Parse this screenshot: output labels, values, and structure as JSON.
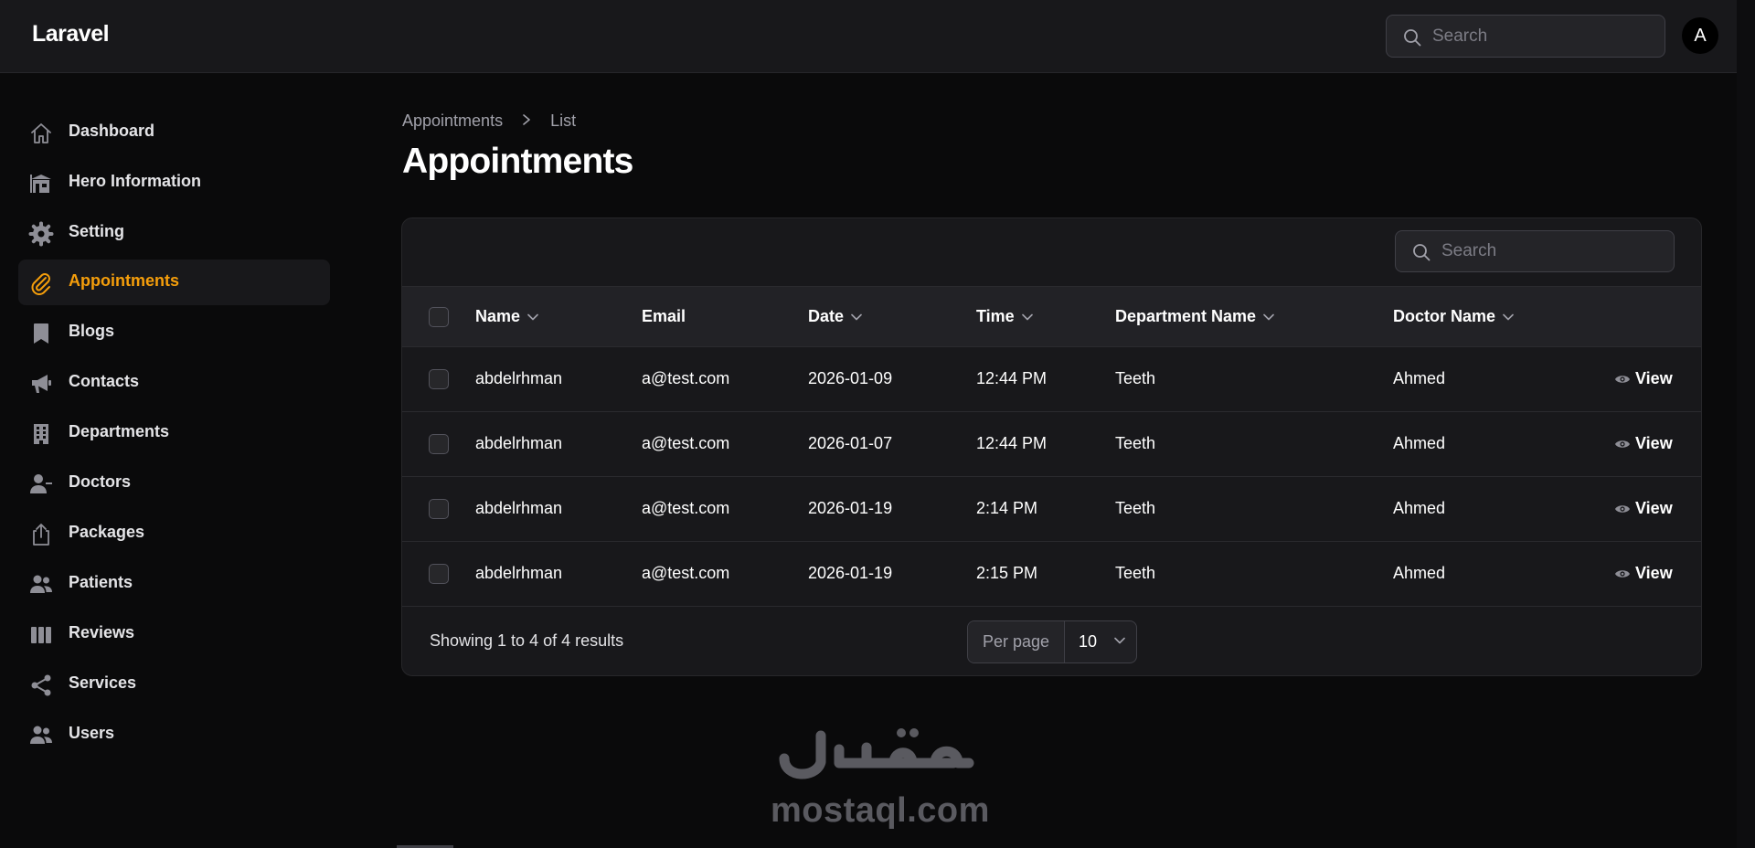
{
  "app": {
    "brand": "Laravel",
    "avatar_initial": "A",
    "accent": "#f59e0b"
  },
  "topbar": {
    "search_placeholder": "Search"
  },
  "sidebar": {
    "items": [
      {
        "label": "Dashboard",
        "icon": "home-icon",
        "active": false
      },
      {
        "label": "Hero Information",
        "icon": "building-store-icon",
        "active": false
      },
      {
        "label": "Setting",
        "icon": "gear-icon",
        "active": false
      },
      {
        "label": "Appointments",
        "icon": "paperclip-icon",
        "active": true
      },
      {
        "label": "Blogs",
        "icon": "bookmark-icon",
        "active": false
      },
      {
        "label": "Contacts",
        "icon": "megaphone-icon",
        "active": false
      },
      {
        "label": "Departments",
        "icon": "office-building-icon",
        "active": false
      },
      {
        "label": "Doctors",
        "icon": "user-minus-icon",
        "active": false
      },
      {
        "label": "Packages",
        "icon": "share-upload-icon",
        "active": false
      },
      {
        "label": "Patients",
        "icon": "users-icon",
        "active": false
      },
      {
        "label": "Reviews",
        "icon": "view-columns-icon",
        "active": false
      },
      {
        "label": "Services",
        "icon": "share-nodes-icon",
        "active": false
      },
      {
        "label": "Users",
        "icon": "users-group-icon",
        "active": false
      }
    ]
  },
  "breadcrumb": {
    "parent": "Appointments",
    "current": "List"
  },
  "page": {
    "title": "Appointments"
  },
  "table": {
    "search_placeholder": "Search",
    "columns": {
      "name": "Name",
      "email": "Email",
      "date": "Date",
      "time": "Time",
      "department": "Department Name",
      "doctor": "Doctor Name"
    },
    "rows": [
      {
        "name": "abdelrhman",
        "email": "a@test.com",
        "date": "2026-01-09",
        "time": "12:44 PM",
        "department": "Teeth",
        "doctor": "Ahmed",
        "action": "View"
      },
      {
        "name": "abdelrhman",
        "email": "a@test.com",
        "date": "2026-01-07",
        "time": "12:44 PM",
        "department": "Teeth",
        "doctor": "Ahmed",
        "action": "View"
      },
      {
        "name": "abdelrhman",
        "email": "a@test.com",
        "date": "2026-01-19",
        "time": "2:14 PM",
        "department": "Teeth",
        "doctor": "Ahmed",
        "action": "View"
      },
      {
        "name": "abdelrhman",
        "email": "a@test.com",
        "date": "2026-01-19",
        "time": "2:15 PM",
        "department": "Teeth",
        "doctor": "Ahmed",
        "action": "View"
      }
    ],
    "footer": {
      "summary": "Showing 1 to 4 of 4 results",
      "per_page_label": "Per page",
      "per_page_value": "10"
    }
  },
  "watermark": {
    "arabic": "مستقل",
    "text": "mostaql.com"
  }
}
